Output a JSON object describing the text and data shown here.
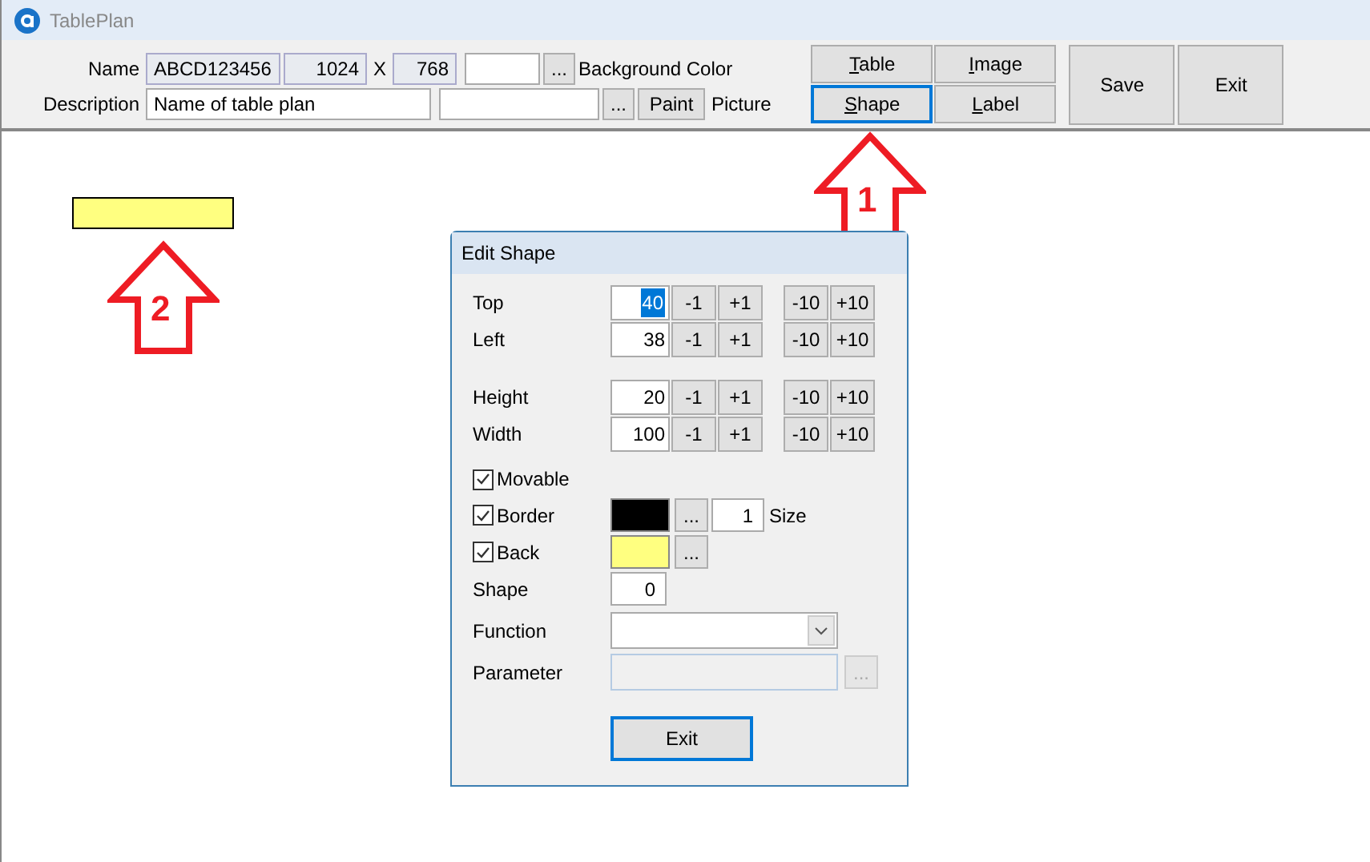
{
  "window": {
    "title": "TablePlan"
  },
  "toolbar": {
    "name_label": "Name",
    "name_value": "ABCD123456",
    "width_value": "1024",
    "x_label": "X",
    "height_value": "768",
    "bg_browse": "...",
    "bg_label": "Background Color",
    "description_label": "Description",
    "description_value": "Name of table plan",
    "picture_browse": "...",
    "paint_button": "Paint",
    "picture_label": "Picture",
    "mode_buttons": [
      {
        "label": "Table",
        "selected": false
      },
      {
        "label": "Image",
        "selected": false
      },
      {
        "label": "Shape",
        "selected": true
      },
      {
        "label": "Label",
        "selected": false
      }
    ],
    "actions": [
      "Save",
      "Exit"
    ]
  },
  "canvas": {
    "shape": {
      "color": "#ffff80"
    },
    "annotations": [
      {
        "number": "1"
      },
      {
        "number": "2"
      }
    ]
  },
  "dialog": {
    "title": "Edit Shape",
    "numeric_rows": [
      {
        "label": "Top",
        "value": "40",
        "selected": true,
        "buttons": [
          "-1",
          "+1",
          "-10",
          "+10"
        ]
      },
      {
        "label": "Left",
        "value": "38",
        "selected": false,
        "buttons": [
          "-1",
          "+1",
          "-10",
          "+10"
        ]
      },
      {
        "label": "Height",
        "value": "20",
        "selected": false,
        "buttons": [
          "-1",
          "+1",
          "-10",
          "+10"
        ]
      },
      {
        "label": "Width",
        "value": "100",
        "selected": false,
        "buttons": [
          "-1",
          "+1",
          "-10",
          "+10"
        ]
      }
    ],
    "movable": {
      "label": "Movable",
      "checked": true
    },
    "border": {
      "label": "Border",
      "checked": true,
      "color": "#000000",
      "browse": "...",
      "size": "1",
      "size_label": "Size"
    },
    "back": {
      "label": "Back",
      "checked": true,
      "color": "#ffff80",
      "browse": "..."
    },
    "shape": {
      "label": "Shape",
      "value": "0"
    },
    "function": {
      "label": "Function"
    },
    "parameter": {
      "label": "Parameter",
      "browse": "...",
      "disabled": true
    },
    "exit": "Exit"
  }
}
